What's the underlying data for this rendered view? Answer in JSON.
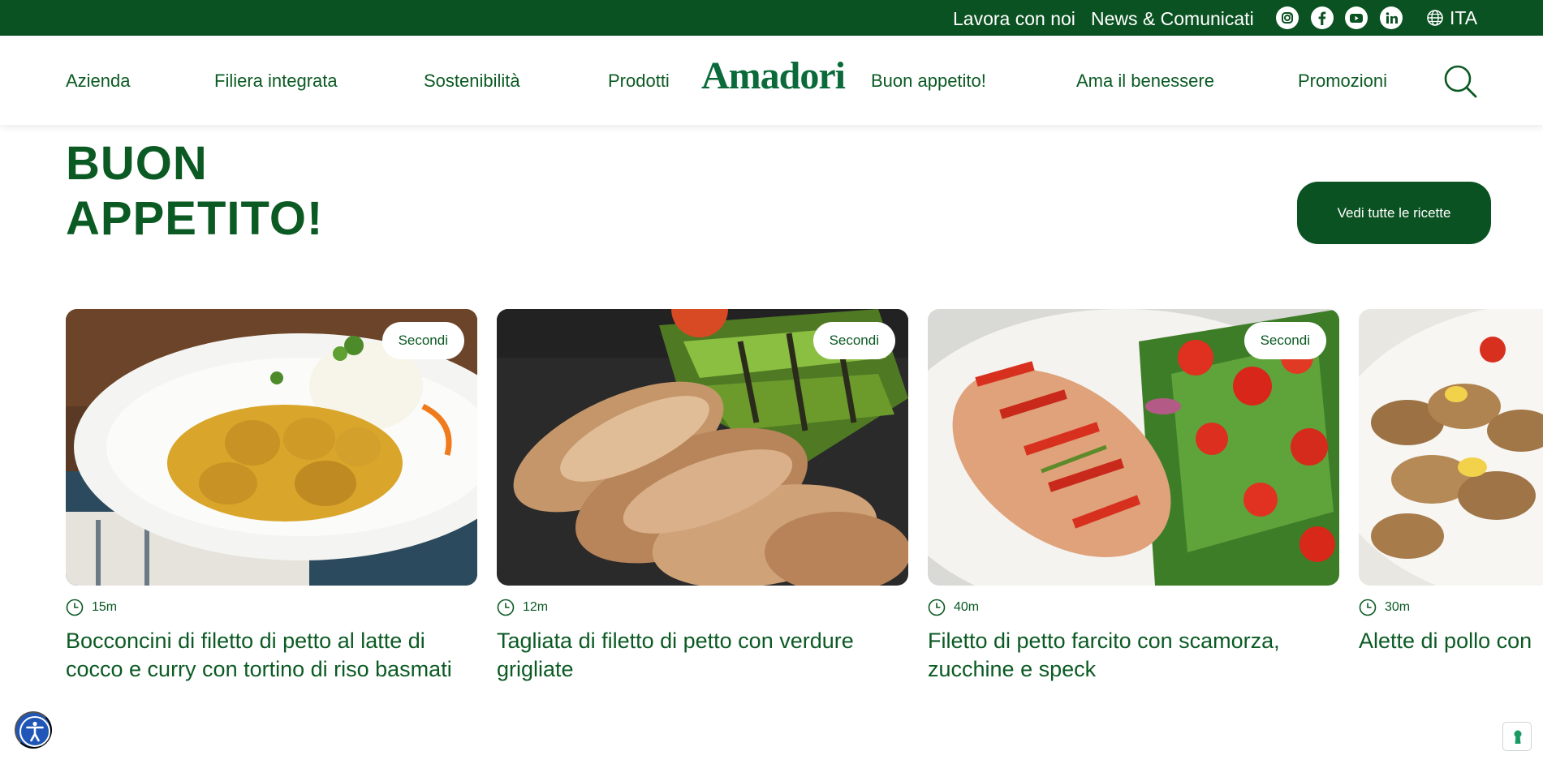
{
  "topbar": {
    "links": [
      "Lavora con noi",
      "News & Comunicati"
    ],
    "social_icons": [
      "instagram-icon",
      "facebook-icon",
      "youtube-icon",
      "linkedin-icon"
    ],
    "language": "ITA"
  },
  "nav": {
    "logo": "Amadori",
    "items": [
      "Azienda",
      "Filiera integrata",
      "Sostenibilità",
      "Prodotti",
      "Buon appetito!",
      "Ama il benessere",
      "Promozioni"
    ]
  },
  "section": {
    "title_line1": "BUON",
    "title_line2": "APPETITO!",
    "button": "Vedi tutte le ricette"
  },
  "cards": [
    {
      "badge": "Secondi",
      "time": "15m",
      "title": "Bocconcini di filetto di petto al latte di cocco e curry con tortino di riso basmati"
    },
    {
      "badge": "Secondi",
      "time": "12m",
      "title": "Tagliata di filetto di petto con verdure grigliate"
    },
    {
      "badge": "Secondi",
      "time": "40m",
      "title": "Filetto di petto farcito con scamorza, zucchine e speck"
    },
    {
      "badge": "",
      "time": "30m",
      "title": "Alette di pollo con"
    }
  ],
  "colors": {
    "brand_green": "#0b5222",
    "text_green": "#0b5a23",
    "logo_dot_red": "#d51d2c",
    "accessibility_blue": "#1f56b7"
  }
}
